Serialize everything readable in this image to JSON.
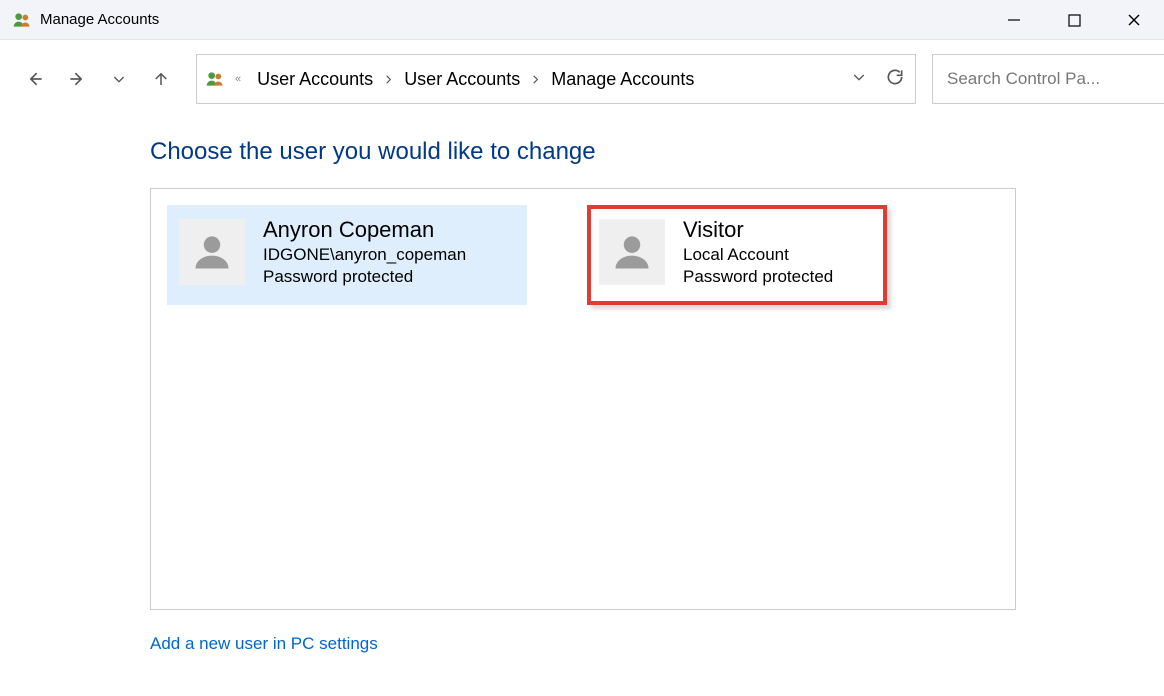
{
  "window": {
    "title": "Manage Accounts"
  },
  "breadcrumbs": {
    "items": [
      "User Accounts",
      "User Accounts",
      "Manage Accounts"
    ]
  },
  "search": {
    "placeholder": "Search Control Pa..."
  },
  "page": {
    "heading": "Choose the user you would like to change",
    "add_user_link": "Add a new user in PC settings"
  },
  "accounts": [
    {
      "name": "Anyron Copeman",
      "subtitle": "IDGONE\\anyron_copeman",
      "status": "Password protected"
    },
    {
      "name": "Visitor",
      "subtitle": "Local Account",
      "status": "Password protected"
    }
  ]
}
